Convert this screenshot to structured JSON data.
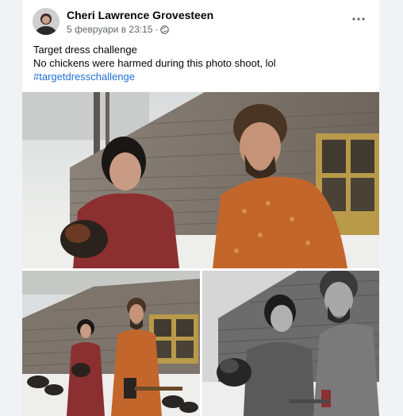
{
  "post": {
    "author": "Cheri Lawrence Grovesteen",
    "date": "5 февруари в 23:15",
    "separator": "·",
    "privacy_icon": "globe-icon",
    "more_icon": "more-horizontal-icon",
    "text_line1": "Target dress challenge",
    "text_line2": "No chickens were harmed during this photo shoot, lol",
    "hashtag": "#targetdresschallenge"
  },
  "colors": {
    "background": "#f0f2f5",
    "card": "#ffffff",
    "name": "#050505",
    "meta": "#65676b",
    "link": "#216fdb"
  },
  "photos": [
    {
      "description_icon": "photo-couple-with-chicken"
    },
    {
      "description_icon": "photo-couple-full-body-color"
    },
    {
      "description_icon": "photo-couple-grayscale-color-splash"
    }
  ]
}
